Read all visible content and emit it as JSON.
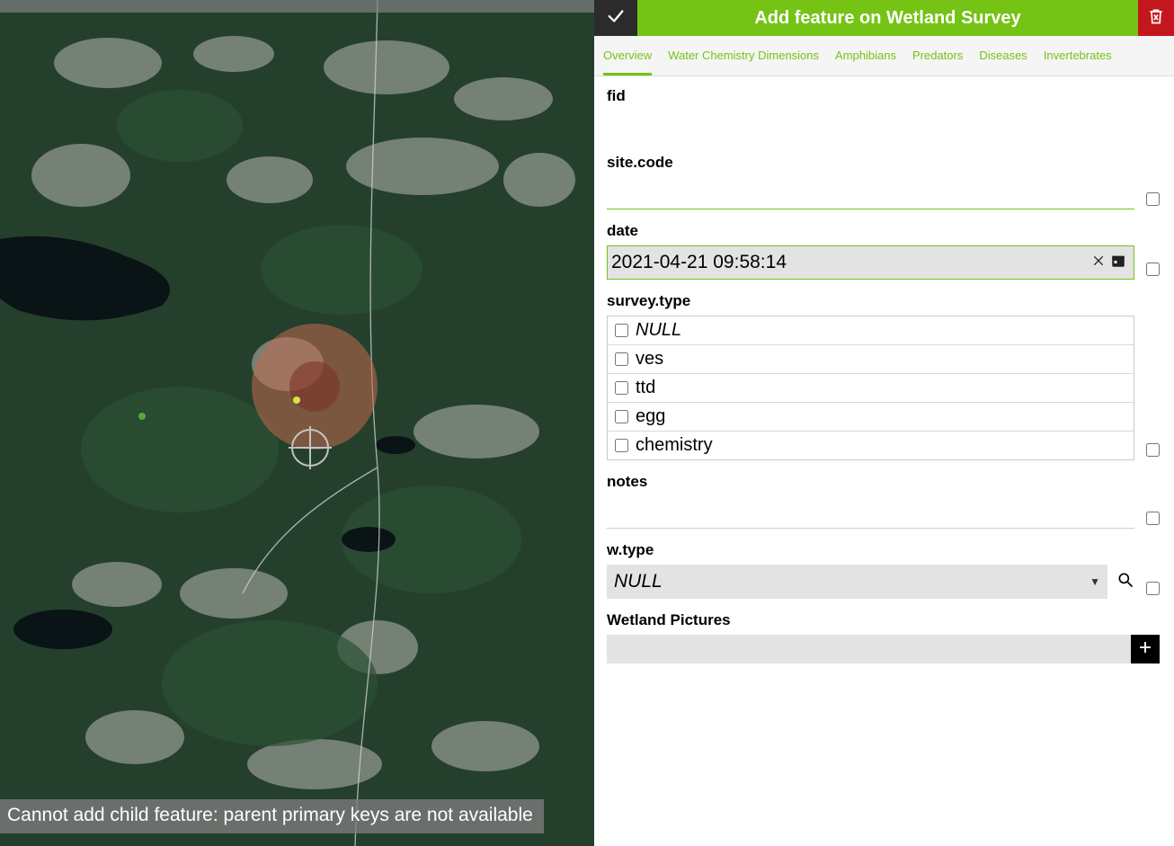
{
  "header": {
    "title": "Add feature on Wetland Survey"
  },
  "tabs": [
    {
      "label": "Overview",
      "active": true
    },
    {
      "label": "Water Chemistry Dimensions",
      "active": false
    },
    {
      "label": "Amphibians",
      "active": false
    },
    {
      "label": "Predators",
      "active": false
    },
    {
      "label": "Diseases",
      "active": false
    },
    {
      "label": "Invertebrates",
      "active": false
    }
  ],
  "fields": {
    "fid": {
      "label": "fid",
      "value": ""
    },
    "site_code": {
      "label": "site.code",
      "value": ""
    },
    "date": {
      "label": "date",
      "value": "2021-04-21 09:58:14"
    },
    "survey_type": {
      "label": "survey.type",
      "options": [
        {
          "label": "NULL",
          "null": true
        },
        {
          "label": "ves"
        },
        {
          "label": "ttd"
        },
        {
          "label": "egg"
        },
        {
          "label": "chemistry"
        }
      ]
    },
    "notes": {
      "label": "notes",
      "value": ""
    },
    "w_type": {
      "label": "w.type",
      "value": "NULL"
    },
    "wetland_pictures": {
      "label": "Wetland Pictures"
    }
  },
  "status_message": "Cannot add child feature: parent primary keys are not available"
}
